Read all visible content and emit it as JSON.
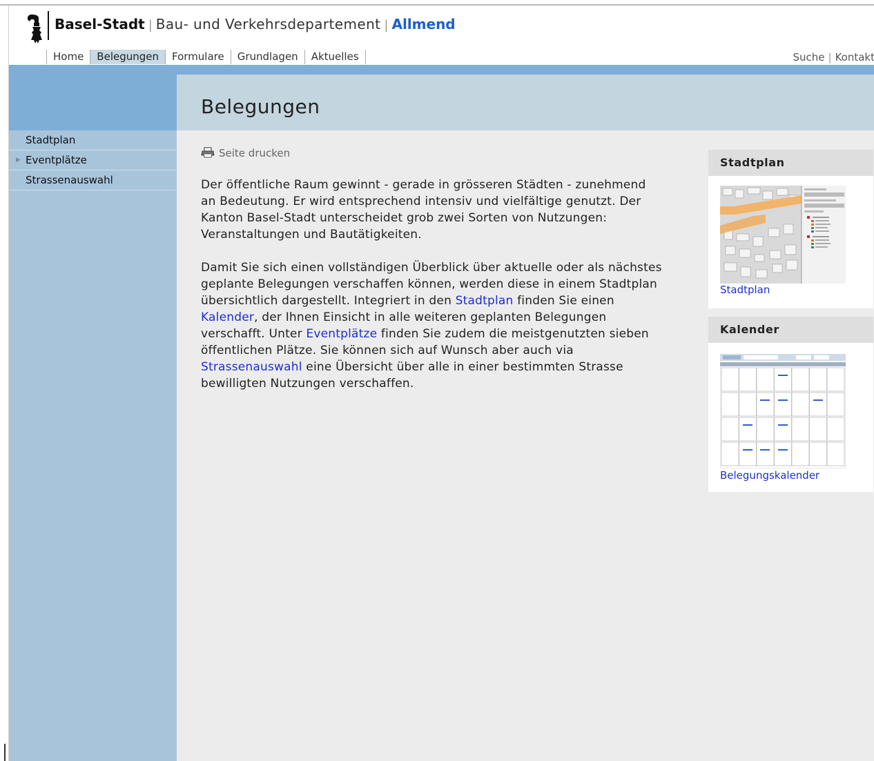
{
  "header": {
    "city": "Basel-Stadt",
    "department": "Bau- und Verkehrsdepartement",
    "section": "Allmend",
    "logo_icon": "basel-crozier-icon"
  },
  "topnav": {
    "items": [
      "Home",
      "Belegungen",
      "Formulare",
      "Grundlagen",
      "Aktuelles"
    ],
    "active": "Belegungen"
  },
  "utility_nav": {
    "search": "Suche",
    "contact": "Kontakt"
  },
  "sidebar": {
    "items": [
      {
        "label": "Stadtplan",
        "icon": ""
      },
      {
        "label": "Eventplätze",
        "icon": "triangle-right-icon"
      },
      {
        "label": "Strassenauswahl",
        "icon": ""
      }
    ]
  },
  "main": {
    "title": "Belegungen",
    "print_label": "Seite drucken",
    "p1": "Der öffentliche Raum gewinnt - gerade in grösseren Städten - zunehmend an Bedeutung. Er wird entsprechend intensiv und vielfältige genutzt. Der Kanton Basel-Stadt unterscheidet grob zwei Sorten von Nutzungen: Veranstaltungen und Bautätigkeiten.",
    "p2": {
      "t1": "Damit Sie sich einen vollständigen Überblick über aktuelle oder als nächstes geplante Belegungen verschaffen können, werden diese in einem Stadtplan übersichtlich dargestellt. Integriert in den ",
      "l1": "Stadtplan",
      "t2": " finden Sie einen ",
      "l2": "Kalender",
      "t3": ", der Ihnen Einsicht in alle weiteren geplanten Belegungen verschafft. Unter ",
      "l3": "Eventplätze",
      "t4": " finden Sie zudem die meistgenutzten sieben öffentlichen Plätze. Sie können sich auf Wunsch aber auch via ",
      "l4": "Strassenauswahl",
      "t5": " eine Übersicht über alle in einer bestimmten Strasse bewilligten Nutzungen verschaffen."
    }
  },
  "aside": {
    "box1": {
      "title": "Stadtplan",
      "link": "Stadtplan"
    },
    "box2": {
      "title": "Kalender",
      "link": "Belegungskalender"
    }
  },
  "colors": {
    "blue_bar": "#7eaed6",
    "sidebar": "#a8c4db",
    "content_head": "#c3d5de",
    "content_bg": "#ececec",
    "link": "#1c2fd0",
    "brand_accent": "#1a60c8"
  }
}
